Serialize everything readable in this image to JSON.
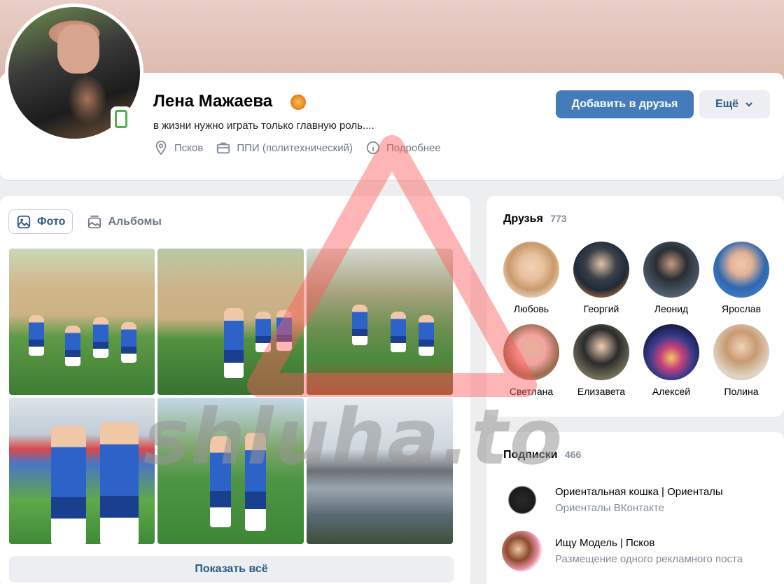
{
  "profile": {
    "name": "Лена Мажаева",
    "status": "в жизни нужно играть только главную роль....",
    "city": "Псков",
    "education": "ППИ (политехнический)",
    "more_info": "Подробнее",
    "add_friend_label": "Добавить в друзья",
    "more_label": "Ещё"
  },
  "photos": {
    "tab_photo": "Фото",
    "tab_albums": "Альбомы",
    "show_all": "Показать всё"
  },
  "friends": {
    "title": "Друзья",
    "count": "773",
    "items": [
      {
        "name": "Любовь"
      },
      {
        "name": "Георгий"
      },
      {
        "name": "Леонид"
      },
      {
        "name": "Ярослав"
      },
      {
        "name": "Светлана"
      },
      {
        "name": "Елизавета"
      },
      {
        "name": "Алексей"
      },
      {
        "name": "Полина"
      }
    ]
  },
  "subscriptions": {
    "title": "Подписки",
    "count": "466",
    "items": [
      {
        "title": "Ориентальная кошка | Ориенталы",
        "desc": "Ориенталы ВКонтакте"
      },
      {
        "title": "Ищу Модель | Псков",
        "desc": "Размещение одного рекламного поста"
      }
    ]
  },
  "watermark": {
    "text": "shluha.to"
  },
  "colors": {
    "accent": "#447bba",
    "link": "#2a5885",
    "online": "#4bb34b",
    "watermark": "#ff6b6b"
  }
}
